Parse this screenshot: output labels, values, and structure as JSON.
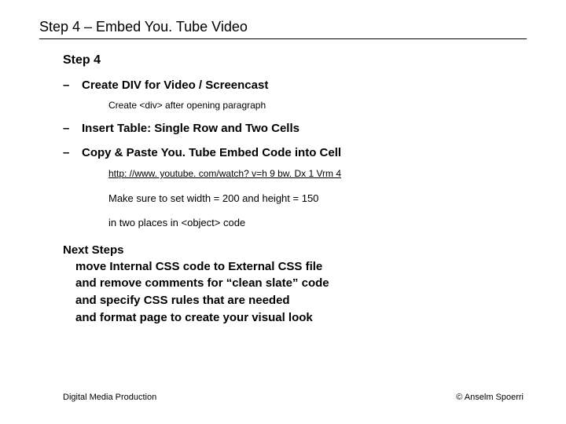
{
  "title": "Step 4 – Embed You. Tube Video",
  "subtitle": "Step 4",
  "bullets": [
    {
      "dash": "–",
      "text": "Create DIV for Video / Screencast",
      "sub": "Create <div> after opening paragraph"
    },
    {
      "dash": "–",
      "text": "Insert Table: Single Row and Two Cells"
    },
    {
      "dash": "–",
      "text": "Copy & Paste You. Tube Embed Code into Cell",
      "link": "http: //www. youtube. com/watch? v=h 9 bw. Dx 1 Vrm 4",
      "note1": "Make sure to set width = 200 and height = 150",
      "note2": "in two places in <object> code"
    }
  ],
  "nextsteps": {
    "heading": "Next Steps",
    "lines": [
      "move Internal CSS code to External CSS file",
      "and remove comments for “clean slate” code",
      "and specify CSS rules that are needed",
      "and format page to create your visual look"
    ]
  },
  "footer": {
    "left": "Digital Media Production",
    "right": "© Anselm Spoerri"
  }
}
